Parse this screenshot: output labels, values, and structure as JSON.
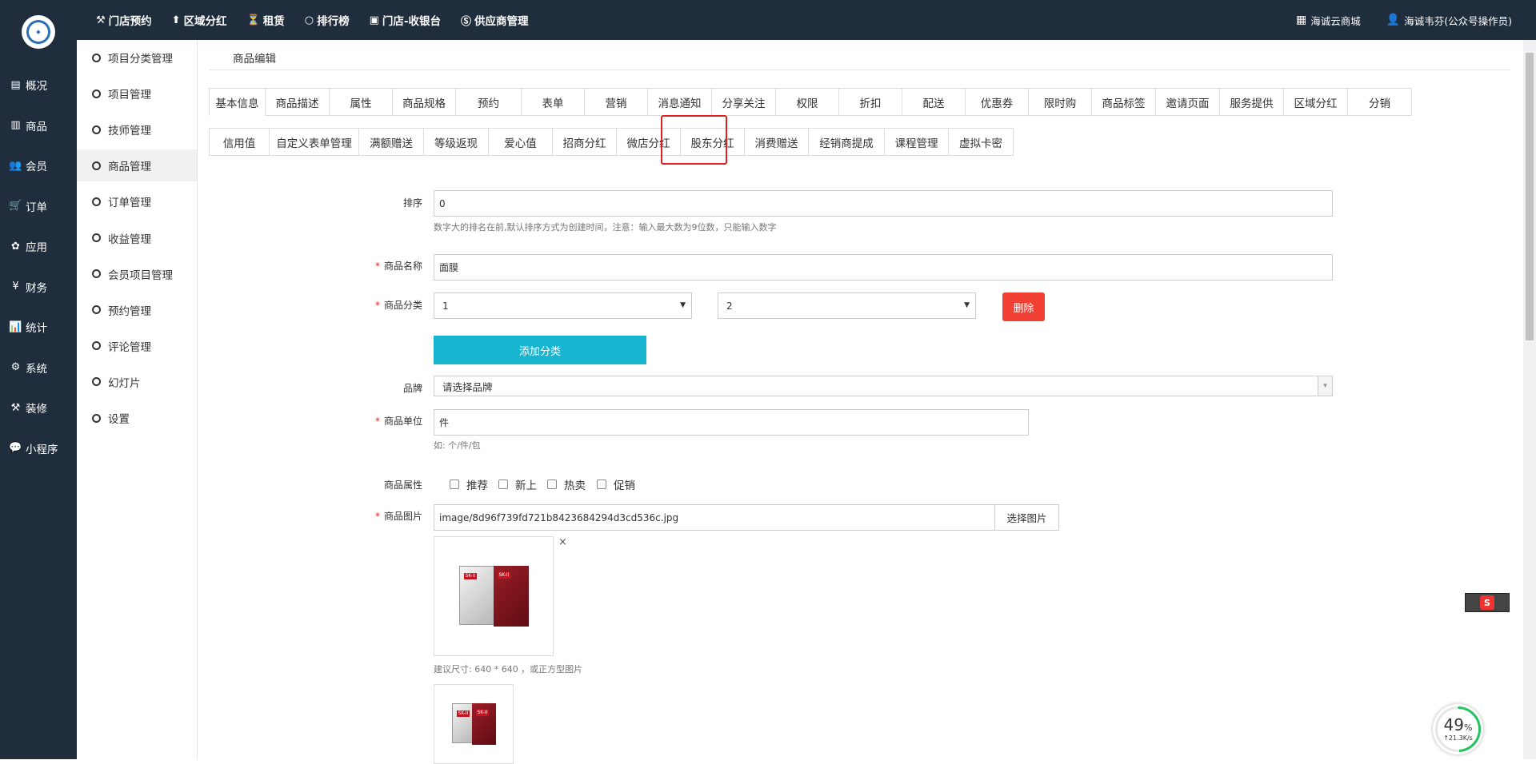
{
  "topnav": [
    {
      "icon": "hammer-icon",
      "glyph": "⚒",
      "label": "门店预约"
    },
    {
      "icon": "person-icon",
      "glyph": "⬆",
      "label": "区域分红"
    },
    {
      "icon": "hourglass-icon",
      "glyph": "⏳",
      "label": "租赁"
    },
    {
      "icon": "circle-icon",
      "glyph": "○",
      "label": "排行榜"
    },
    {
      "icon": "camera-icon",
      "glyph": "▣",
      "label": "门店-收银台"
    },
    {
      "icon": "skype-icon",
      "glyph": "Ⓢ",
      "label": "供应商管理"
    }
  ],
  "topright": {
    "shop": {
      "icon": "grid-icon",
      "glyph": "▦",
      "label": "海诚云商城"
    },
    "user": {
      "icon": "user-icon",
      "glyph": "👤",
      "label": "海诚韦芬(公众号操作员)"
    }
  },
  "sidebar": [
    {
      "icon": "overview-icon",
      "glyph": "▤",
      "label": "概况"
    },
    {
      "icon": "goods-icon",
      "glyph": "▥",
      "label": "商品"
    },
    {
      "icon": "members-icon",
      "glyph": "👥",
      "label": "会员"
    },
    {
      "icon": "cart-icon",
      "glyph": "🛒",
      "label": "订单"
    },
    {
      "icon": "apps-icon",
      "glyph": "✿",
      "label": "应用"
    },
    {
      "icon": "yen-icon",
      "glyph": "¥",
      "label": "财务"
    },
    {
      "icon": "stats-icon",
      "glyph": "📊",
      "label": "统计"
    },
    {
      "icon": "system-icon",
      "glyph": "⚙",
      "label": "系统"
    },
    {
      "icon": "decorate-icon",
      "glyph": "⚒",
      "label": "装修"
    },
    {
      "icon": "wechat-icon",
      "glyph": "💬",
      "label": "小程序"
    }
  ],
  "submenu": [
    {
      "label": "项目分类管理"
    },
    {
      "label": "项目管理"
    },
    {
      "label": "技师管理"
    },
    {
      "label": "商品管理",
      "active": true
    },
    {
      "label": "订单管理"
    },
    {
      "label": "收益管理"
    },
    {
      "label": "会员项目管理"
    },
    {
      "label": "预约管理"
    },
    {
      "label": "评论管理"
    },
    {
      "label": "幻灯片"
    },
    {
      "label": "设置"
    }
  ],
  "breadcrumb": "商品编辑",
  "tabs_row1": [
    "基本信息",
    "商品描述",
    "属性",
    "商品规格",
    "预约",
    "表单",
    "营销",
    "消息通知",
    "分享关注",
    "权限",
    "折扣",
    "配送",
    "优惠券",
    "限时购",
    "商品标签",
    "邀请页面",
    "服务提供",
    "区域分红",
    "分销"
  ],
  "tabs_row2": [
    "信用值",
    "自定义表单管理",
    "满额赠送",
    "等级返现",
    "爱心值",
    "招商分红",
    "微店分红",
    "股东分红",
    "消费赠送",
    "经销商提成",
    "课程管理",
    "虚拟卡密"
  ],
  "form": {
    "sort_label": "排序",
    "sort_value": "0",
    "sort_help": "数字大的排名在前,默认排序方式为创建时间，注意：输入最大数为9位数，只能输入数字",
    "name_label": "商品名称",
    "name_value": "面膜",
    "cat_label": "商品分类",
    "cat1": "1",
    "cat2": "2",
    "delete_btn": "删除",
    "add_cat_btn": "添加分类",
    "brand_label": "品牌",
    "brand_value": "请选择品牌",
    "unit_label": "商品单位",
    "unit_value": "件",
    "unit_help": "如: 个/件/包",
    "attr_label": "商品属性",
    "attrs": [
      "推荐",
      "新上",
      "热卖",
      "促销"
    ],
    "img_label": "商品图片",
    "img_value": "image/8d96f739fd721b8423684294d3cd536c.jpg",
    "img_btn": "选择图片",
    "img_close": "×",
    "img_help": "建议尺寸: 640 * 640 ，或正方型图片",
    "mask_brand": "SK-II"
  },
  "colors": {
    "dark": "#1f2d3d",
    "danger": "#f04134",
    "primary": "#17b5cf",
    "highlight": "#e02020"
  },
  "ime": {
    "glyph": "S"
  },
  "speed": {
    "percent": "49",
    "unit": "%",
    "rate": "↑21.3K/s",
    "fraction": 0.49
  }
}
